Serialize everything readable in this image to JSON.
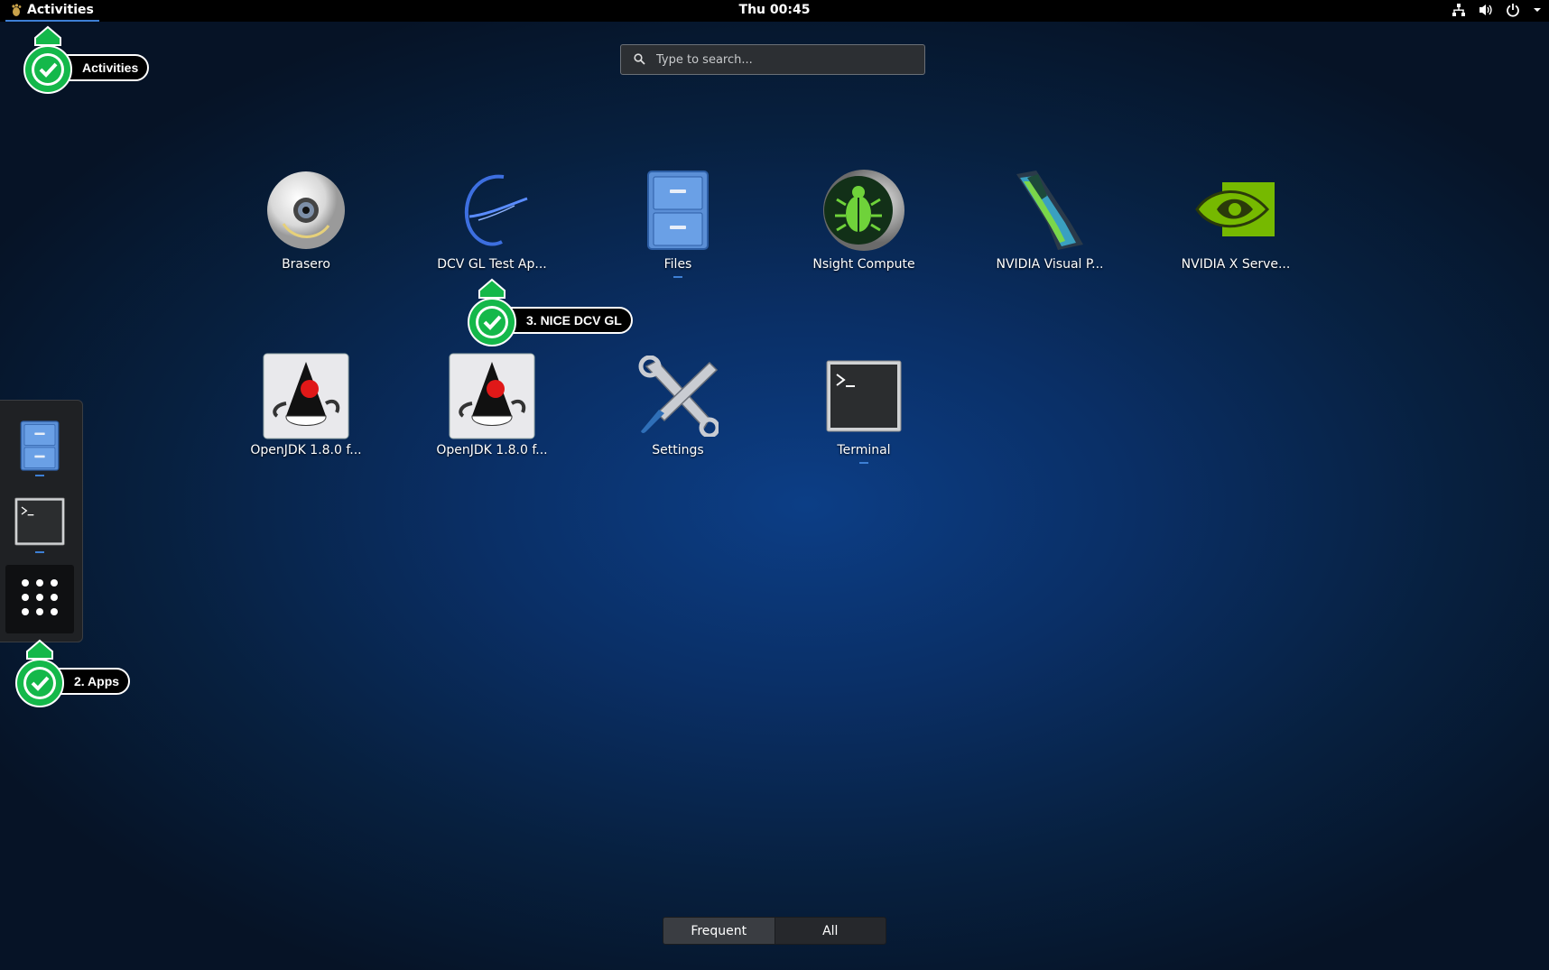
{
  "topbar": {
    "activities_label": "Activities",
    "clock": "Thu 00:45",
    "tray_icons": [
      "network-icon",
      "volume-icon",
      "power-icon",
      "menu-arrow-icon"
    ]
  },
  "search": {
    "placeholder": "Type to search..."
  },
  "apps": [
    {
      "label": "Brasero",
      "icon": "disc-icon",
      "running": false
    },
    {
      "label": "DCV GL Test Ap...",
      "icon": "dcv-gl-icon",
      "running": false
    },
    {
      "label": "Files",
      "icon": "file-cabinet-icon",
      "running": true
    },
    {
      "label": "Nsight Compute",
      "icon": "nsight-bug-icon",
      "running": false
    },
    {
      "label": "NVIDIA Visual P...",
      "icon": "nvidia-visual-profiler-icon",
      "running": false
    },
    {
      "label": "NVIDIA X Serve...",
      "icon": "nvidia-eye-icon",
      "running": false
    },
    {
      "label": "OpenJDK 1.8.0 f...",
      "icon": "java-duke-icon",
      "running": false
    },
    {
      "label": "OpenJDK 1.8.0 f...",
      "icon": "java-duke-icon",
      "running": false
    },
    {
      "label": "Settings",
      "icon": "tools-icon",
      "running": false
    },
    {
      "label": "Terminal",
      "icon": "terminal-icon",
      "running": true
    }
  ],
  "dash": {
    "items": [
      "file-cabinet-icon",
      "terminal-icon",
      "apps-grid-icon"
    ]
  },
  "callouts": {
    "activities": "Activities",
    "apps": "2. Apps",
    "dcv": "3. NICE DCV GL"
  },
  "view_tabs": {
    "frequent": "Frequent",
    "all": "All"
  },
  "colors": {
    "accent": "#3d7fd4",
    "callout_green": "#00c853"
  }
}
